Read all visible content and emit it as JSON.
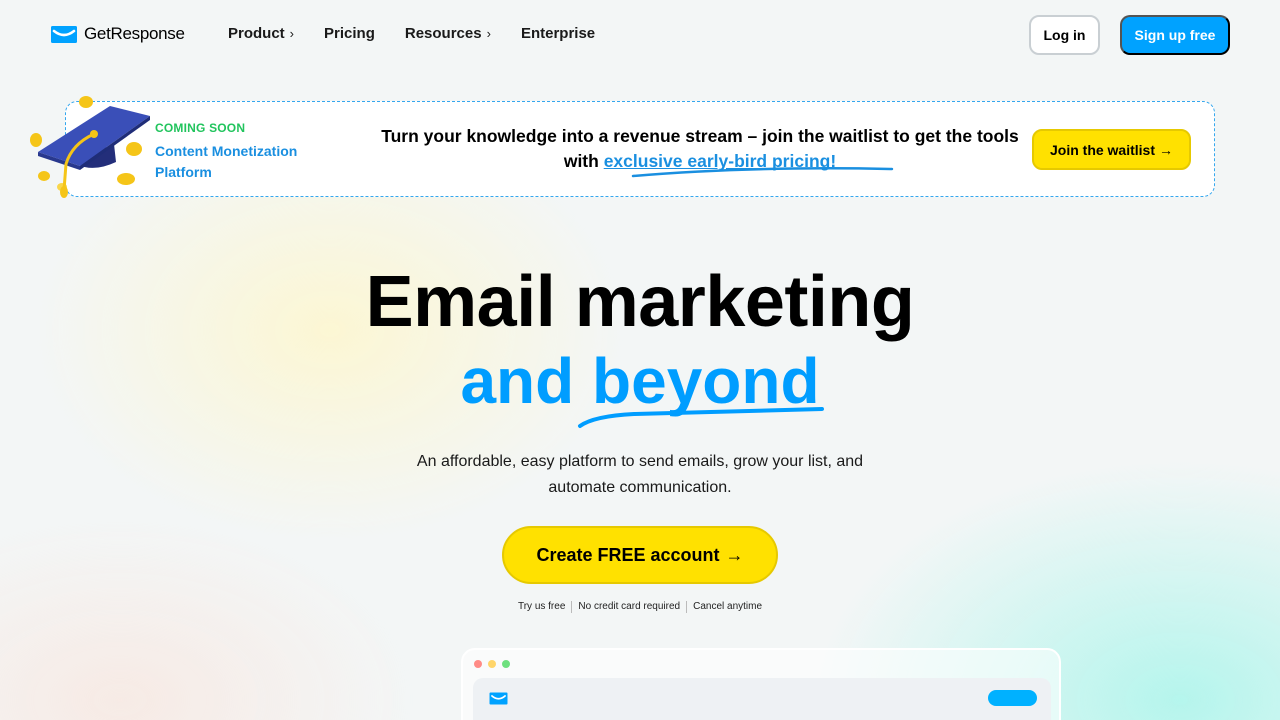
{
  "brand": {
    "name": "GetResponse",
    "accent": "#00a2ff"
  },
  "nav": {
    "links": [
      {
        "label": "Product",
        "chevron": "›"
      },
      {
        "label": "Pricing"
      },
      {
        "label": "Resources",
        "chevron": "›"
      },
      {
        "label": "Enterprise"
      }
    ],
    "login_label": "Log in",
    "signup_label": "Sign up free"
  },
  "banner": {
    "eyebrow": "COMING SOON",
    "product": "Content Monetization Platform",
    "headline": "Turn your knowledge into a revenue stream – join the waitlist to get the tools with",
    "link_text": "exclusive early-bird pricing!",
    "cta_label": "Join the waitlist",
    "cta_arrow": "→",
    "icon": "graduation-cap-with-coins"
  },
  "hero": {
    "title": "Email marketing",
    "subtitle": "and beyond",
    "description": "An affordable, easy platform to send emails, grow your list, and automate communication.",
    "cta_label": "Create FREE account",
    "cta_arrow": "→",
    "perks": [
      "Try us free",
      "No credit card required",
      "Cancel anytime"
    ]
  },
  "colors": {
    "cta_yellow": "#ffe100",
    "link_blue": "#1a8fe0",
    "coming_green": "#21c45d",
    "subtitle_blue": "#009dff"
  }
}
